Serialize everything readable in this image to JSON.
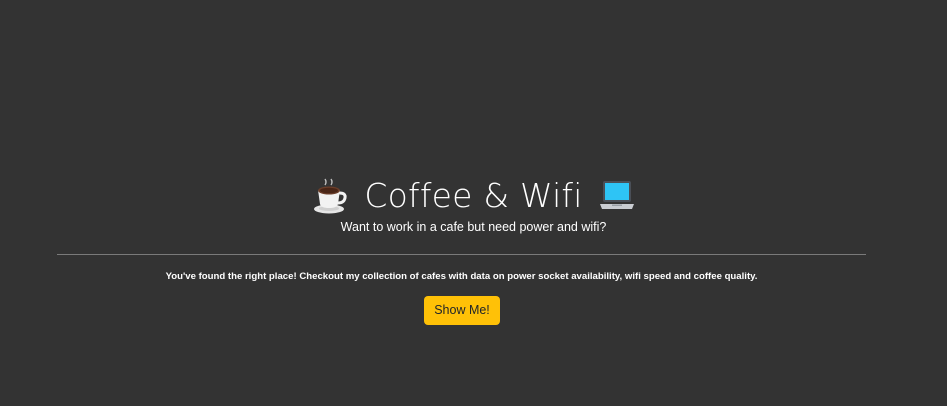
{
  "hero": {
    "title": "Coffee & Wifi",
    "title_icon_left": "coffee-cup-icon",
    "title_icon_right": "laptop-icon",
    "subtitle": "Want to work in a cafe but need power and wifi?",
    "lead": "You've found the right place! Checkout my collection of cafes with data on power socket availability, wifi speed and coffee quality.",
    "cta_label": "Show Me!"
  },
  "colors": {
    "background": "#333333",
    "text": "#ffffff",
    "divider": "#7a7a7a",
    "button": "#ffc107",
    "button_text": "#212529"
  }
}
